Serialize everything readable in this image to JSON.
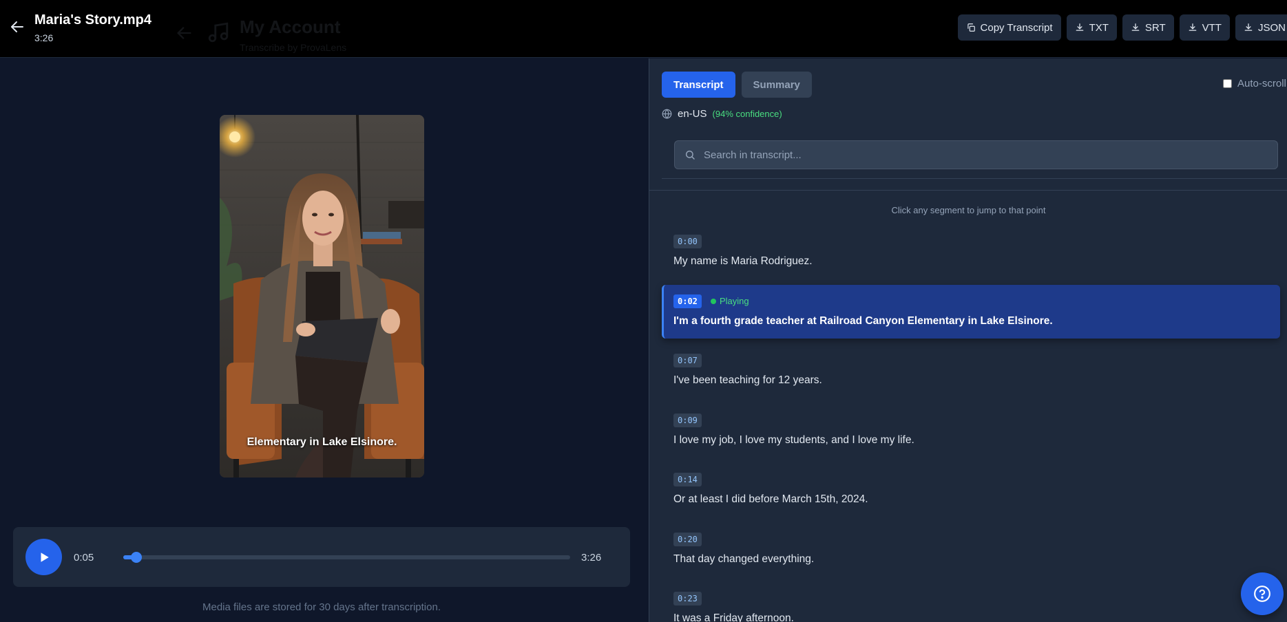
{
  "header": {
    "file_name": "Maria's Story.mp4",
    "duration": "3:26",
    "background_title": "My Account",
    "background_subtitle": "Transcribe by ProvaLens",
    "actions": [
      {
        "label": "Copy Transcript",
        "icon": "copy-icon"
      },
      {
        "label": "TXT",
        "icon": "download-icon"
      },
      {
        "label": "SRT",
        "icon": "download-icon"
      },
      {
        "label": "VTT",
        "icon": "download-icon"
      },
      {
        "label": "JSON",
        "icon": "download-icon"
      }
    ]
  },
  "video": {
    "caption": "Elementary in Lake Elsinore."
  },
  "player": {
    "current_time": "0:05",
    "total_time": "3:26",
    "progress": 0.03
  },
  "storage_note": "Media files are stored for 30 days after transcription.",
  "transcript": {
    "tabs": [
      {
        "label": "Transcript",
        "active": true
      },
      {
        "label": "Summary",
        "active": false
      }
    ],
    "auto_scroll_label": "Auto-scroll",
    "auto_scroll_checked": false,
    "language": "en-US",
    "confidence": "(94% confidence)",
    "search_placeholder": "Search in transcript...",
    "hint": "Click any segment to jump to that point",
    "playing_label": "Playing",
    "segments": [
      {
        "time": "0:00",
        "text": "My name is Maria Rodriguez.",
        "playing": false
      },
      {
        "time": "0:02",
        "text": "I'm a fourth grade teacher at Railroad Canyon Elementary in Lake Elsinore.",
        "playing": true
      },
      {
        "time": "0:07",
        "text": "I've been teaching for 12 years.",
        "playing": false
      },
      {
        "time": "0:09",
        "text": "I love my job, I love my students, and I love my life.",
        "playing": false
      },
      {
        "time": "0:14",
        "text": "Or at least I did before March 15th, 2024.",
        "playing": false
      },
      {
        "time": "0:20",
        "text": "That day changed everything.",
        "playing": false
      },
      {
        "time": "0:23",
        "text": "It was a Friday afternoon.",
        "playing": false
      }
    ]
  },
  "colors": {
    "accent": "#2563eb",
    "playing_green": "#4ade80",
    "panel": "#1e293b",
    "background": "#0f172a"
  }
}
